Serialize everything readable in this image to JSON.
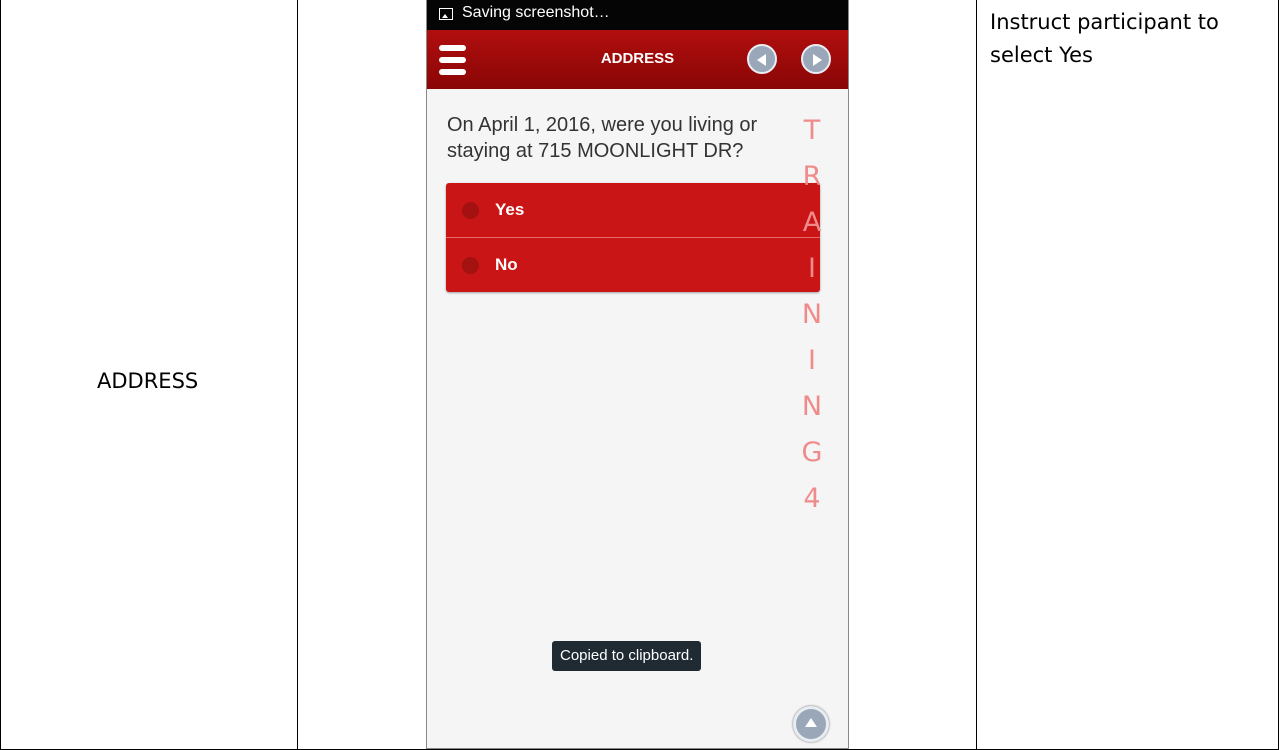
{
  "table": {
    "section_label": "ADDRESS",
    "instruction": "Instruct participant to select Yes"
  },
  "phone": {
    "status_bar": {
      "text": "Saving screenshot…",
      "icon": "image-icon"
    },
    "app_bar": {
      "title": "ADDRESS",
      "menu_icon": "hamburger-icon",
      "prev_icon": "arrow-left-circle-icon",
      "next_icon": "arrow-right-circle-icon",
      "color": "#9e0b0b"
    },
    "question": "On April 1, 2016, were you living or staying at 715 MOONLIGHT DR?",
    "options": [
      {
        "label": "Yes"
      },
      {
        "label": "No"
      }
    ],
    "option_color": "#c91515",
    "watermark": [
      "T",
      "R",
      "A",
      "I",
      "N",
      "I",
      "N",
      "G",
      "4"
    ],
    "watermark_color": "#f08b8b",
    "toast": "Copied to clipboard.",
    "scroll_top_icon": "arrow-up-circle-icon"
  }
}
